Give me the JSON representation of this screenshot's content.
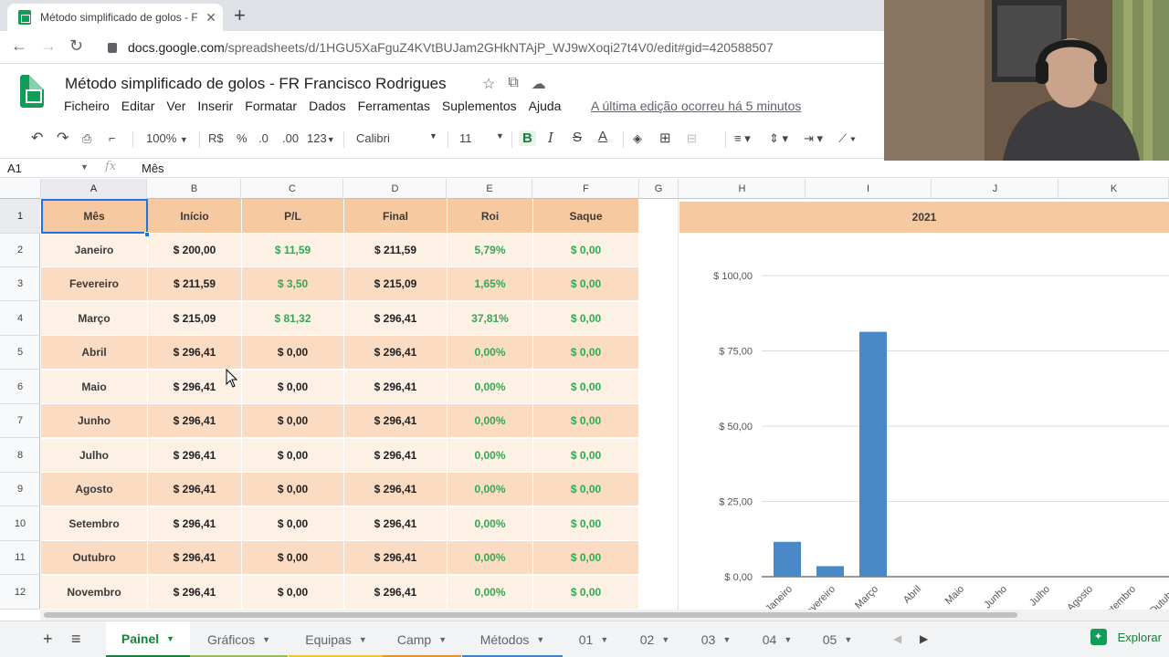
{
  "browser": {
    "tab_title": "Método simplificado de golos - F",
    "tab_close": "✕",
    "new_tab": "+",
    "url_host": "docs.google.com",
    "url_path": "/spreadsheets/d/1HGU5XaFguZ4KVtBUJam2GHkNTAjP_WJ9wXoqi27t4V0/edit#gid=420588507"
  },
  "doc": {
    "title": "Método simplificado de golos - FR Francisco Rodrigues",
    "menu": [
      "Ficheiro",
      "Editar",
      "Ver",
      "Inserir",
      "Formatar",
      "Dados",
      "Ferramentas",
      "Suplementos",
      "Ajuda"
    ],
    "last_edit": "A última edição ocorreu há 5 minutos"
  },
  "toolbar": {
    "zoom": "100%",
    "currency": "R$",
    "percent": "%",
    "dec_less": ".0",
    "dec_more": ".00",
    "format_more": "123",
    "font": "Calibri",
    "font_size": "11",
    "bold": "B",
    "italic": "I",
    "strike": "S",
    "text_color": "A"
  },
  "formula_bar": {
    "cell_ref": "A1",
    "fx": "fx",
    "value": "Mês"
  },
  "columns": [
    "A",
    "B",
    "C",
    "D",
    "E",
    "F",
    "G",
    "H",
    "I",
    "J",
    "K"
  ],
  "rows": [
    "1",
    "2",
    "3",
    "4",
    "5",
    "6",
    "7",
    "8",
    "9",
    "10",
    "11",
    "12"
  ],
  "table": {
    "headers": [
      "Mês",
      "Início",
      "P/L",
      "Final",
      "Roi",
      "Saque"
    ],
    "rows": [
      [
        "Janeiro",
        "$ 200,00",
        "$ 11,59",
        "$ 211,59",
        "5,79%",
        "$ 0,00"
      ],
      [
        "Fevereiro",
        "$ 211,59",
        "$ 3,50",
        "$ 215,09",
        "1,65%",
        "$ 0,00"
      ],
      [
        "Março",
        "$ 215,09",
        "$ 81,32",
        "$ 296,41",
        "37,81%",
        "$ 0,00"
      ],
      [
        "Abril",
        "$ 296,41",
        "$ 0,00",
        "$ 296,41",
        "0,00%",
        "$ 0,00"
      ],
      [
        "Maio",
        "$ 296,41",
        "$ 0,00",
        "$ 296,41",
        "0,00%",
        "$ 0,00"
      ],
      [
        "Junho",
        "$ 296,41",
        "$ 0,00",
        "$ 296,41",
        "0,00%",
        "$ 0,00"
      ],
      [
        "Julho",
        "$ 296,41",
        "$ 0,00",
        "$ 296,41",
        "0,00%",
        "$ 0,00"
      ],
      [
        "Agosto",
        "$ 296,41",
        "$ 0,00",
        "$ 296,41",
        "0,00%",
        "$ 0,00"
      ],
      [
        "Setembro",
        "$ 296,41",
        "$ 0,00",
        "$ 296,41",
        "0,00%",
        "$ 0,00"
      ],
      [
        "Outubro",
        "$ 296,41",
        "$ 0,00",
        "$ 296,41",
        "0,00%",
        "$ 0,00"
      ],
      [
        "Novembro",
        "$ 296,41",
        "$ 0,00",
        "$ 296,41",
        "0,00%",
        "$ 0,00"
      ]
    ]
  },
  "chart_data": {
    "type": "bar",
    "title": "2021",
    "categories": [
      "Janeiro",
      "Fevereiro",
      "Março",
      "Abril",
      "Maio",
      "Junho",
      "Julho",
      "Agosto",
      "Setembro",
      "Outubro"
    ],
    "category_labels_shown": [
      "Janeiro",
      "Fevereiro",
      "Março",
      "Abril",
      "Maio",
      "Junho",
      "Julho",
      "Agosto",
      "Setembro",
      "Outubro"
    ],
    "values": [
      11.59,
      3.5,
      81.32,
      0,
      0,
      0,
      0,
      0,
      0,
      0
    ],
    "yticks": [
      "$ 0,00",
      "$ 25,00",
      "$ 50,00",
      "$ 75,00",
      "$ 100,00"
    ],
    "ylim": [
      0,
      100
    ],
    "grid": true,
    "bar_color": "#4a89c8"
  },
  "sheets": [
    {
      "label": "Painel",
      "active": true,
      "color": "#188038"
    },
    {
      "label": "Gráficos",
      "active": false,
      "color": "#9bbb59"
    },
    {
      "label": "Equipas",
      "active": false,
      "color": "#f1c232"
    },
    {
      "label": "Camp",
      "active": false,
      "color": "#e69138"
    },
    {
      "label": "Métodos",
      "active": false,
      "color": "#3d85c6"
    },
    {
      "label": "01",
      "active": false,
      "color": ""
    },
    {
      "label": "02",
      "active": false,
      "color": ""
    },
    {
      "label": "03",
      "active": false,
      "color": ""
    },
    {
      "label": "04",
      "active": false,
      "color": ""
    },
    {
      "label": "05",
      "active": false,
      "color": ""
    }
  ],
  "explore_label": "Explorar",
  "colors": {
    "header_fill": "#f7c9a1",
    "row_dark": "#fbdcc2",
    "row_light": "#fdf0e4",
    "positive": "#34a853",
    "accent": "#188038"
  }
}
